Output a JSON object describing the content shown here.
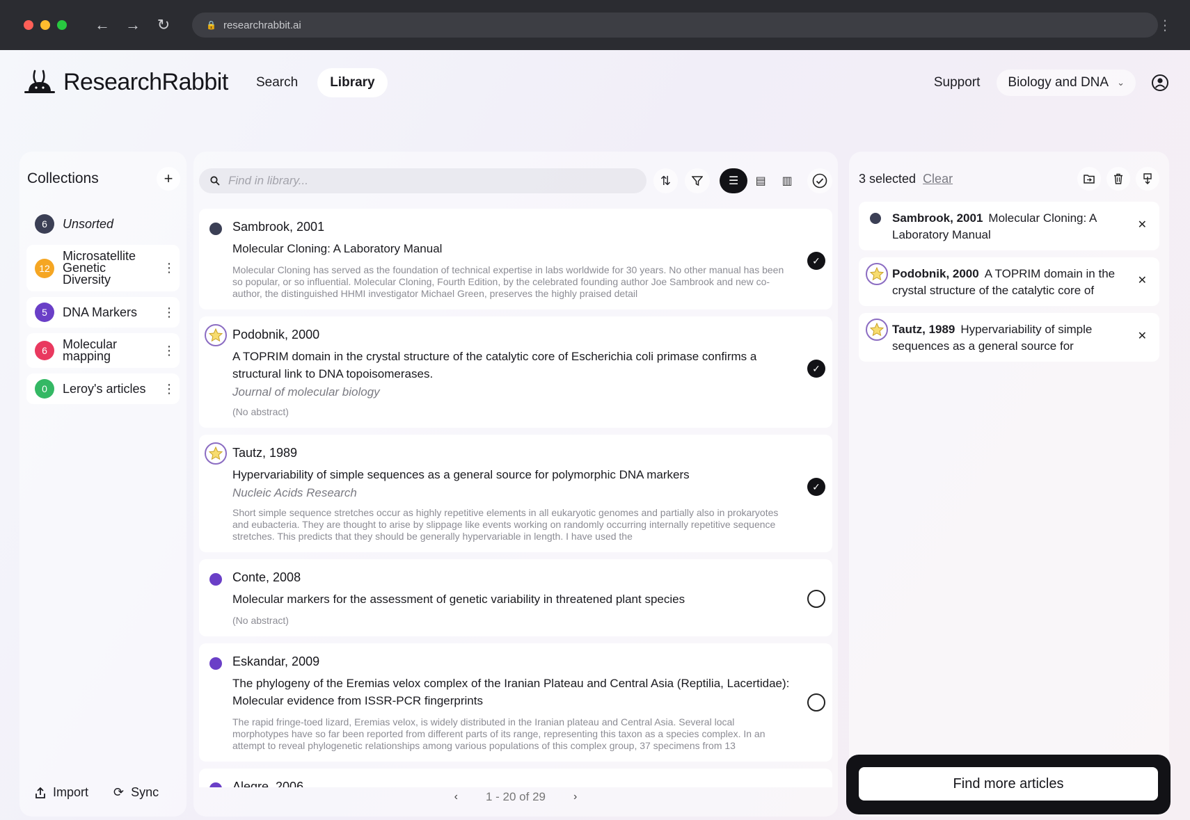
{
  "browser": {
    "url": "researchrabbit.ai",
    "traffic_colors": [
      "#ff5f57",
      "#febc2e",
      "#28c840"
    ]
  },
  "header": {
    "brand": "ResearchRabbit",
    "nav": [
      {
        "label": "Search"
      },
      {
        "label": "Library"
      }
    ],
    "support": "Support",
    "project": "Biology and DNA"
  },
  "collections": {
    "title": "Collections",
    "items": [
      {
        "count": "6",
        "name": "Unsorted",
        "color": "#3b3f55"
      },
      {
        "count": "12",
        "name": "Microsatellite Genetic Diversity",
        "color": "#f5a623"
      },
      {
        "count": "5",
        "name": "DNA Markers",
        "color": "#6a3fc7"
      },
      {
        "count": "6",
        "name": "Molecular mapping",
        "color": "#e9395f"
      },
      {
        "count": "0",
        "name": "Leroy's articles",
        "color": "#34b864"
      }
    ],
    "import_label": "Import",
    "sync_label": "Sync"
  },
  "library": {
    "search_placeholder": "Find in library...",
    "articles": [
      {
        "author": "Sambrook, 2001",
        "title": "Molecular Cloning: A Laboratory Manual",
        "journal": "",
        "abstract": "Molecular Cloning has served as the foundation of technical expertise in labs worldwide for 30 years. No other manual has been so popular, or so influential. Molecular Cloning, Fourth Edition, by the celebrated founding author Joe Sambrook and new co-author, the distinguished HHMI investigator Michael Green, preserves the highly praised detail",
        "marker": "dot",
        "marker_color": "#3b3f55",
        "checked": true
      },
      {
        "author": "Podobnik, 2000",
        "title": "A TOPRIM domain in the crystal structure of the catalytic core of Escherichia coli primase confirms a structural link to DNA topoisomerases.",
        "journal": "Journal of molecular biology",
        "abstract": "(No abstract)",
        "marker": "star",
        "marker_color": "#8b6cc2",
        "checked": true
      },
      {
        "author": "Tautz, 1989",
        "title": "Hypervariability of simple sequences as a general source for polymorphic DNA markers",
        "journal": "Nucleic Acids Research",
        "abstract": "Short simple sequence stretches occur as highly repetitive elements in all eukaryotic genomes and partially also in prokaryotes and eubacteria. They are thought to arise by slippage like events working on randomly occurring internally repetitive sequence stretches. This predicts that they should be generally hypervariable in length. I have used the",
        "marker": "star",
        "marker_color": "#8b6cc2",
        "checked": true
      },
      {
        "author": "Conte, 2008",
        "title": "Molecular markers for the assessment of genetic variability in threatened plant species",
        "journal": "",
        "abstract": "(No abstract)",
        "marker": "dot",
        "marker_color": "#6a3fc7",
        "checked": false
      },
      {
        "author": "Eskandar, 2009",
        "title": "The phylogeny of the Eremias velox complex of the Iranian Plateau and Central Asia (Reptilia, Lacertidae): Molecular evidence from ISSR-PCR fingerprints",
        "journal": "",
        "abstract": "The rapid fringe-toed lizard, Eremias velox, is widely distributed in the Iranian plateau and Central Asia. Several local morphotypes have so far been reported from different parts of its range, representing this taxon as a species complex. In an attempt to reveal phylogenetic relationships among various populations of this complex group, 37 specimens from 13",
        "marker": "dot",
        "marker_color": "#6a3fc7",
        "checked": false
      },
      {
        "author": "Alegre, 2006",
        "title": "",
        "journal": "",
        "abstract": "",
        "marker": "dot",
        "marker_color": "#6a3fc7",
        "checked": false
      }
    ],
    "pagination": "1 - 20 of 29"
  },
  "selection": {
    "count_label": "3 selected",
    "clear_label": "Clear",
    "items": [
      {
        "author": "Sambrook, 2001",
        "title": "Molecular Cloning: A Laboratory Manual",
        "marker": "dot",
        "marker_color": "#3b3f55"
      },
      {
        "author": "Podobnik, 2000",
        "title": "A TOPRIM domain in the crystal structure of the catalytic core of",
        "marker": "star",
        "marker_color": "#8b6cc2"
      },
      {
        "author": "Tautz, 1989",
        "title": "Hypervariability of simple sequences as a general source for",
        "marker": "star",
        "marker_color": "#8b6cc2"
      }
    ],
    "find_more_label": "Find more articles"
  }
}
